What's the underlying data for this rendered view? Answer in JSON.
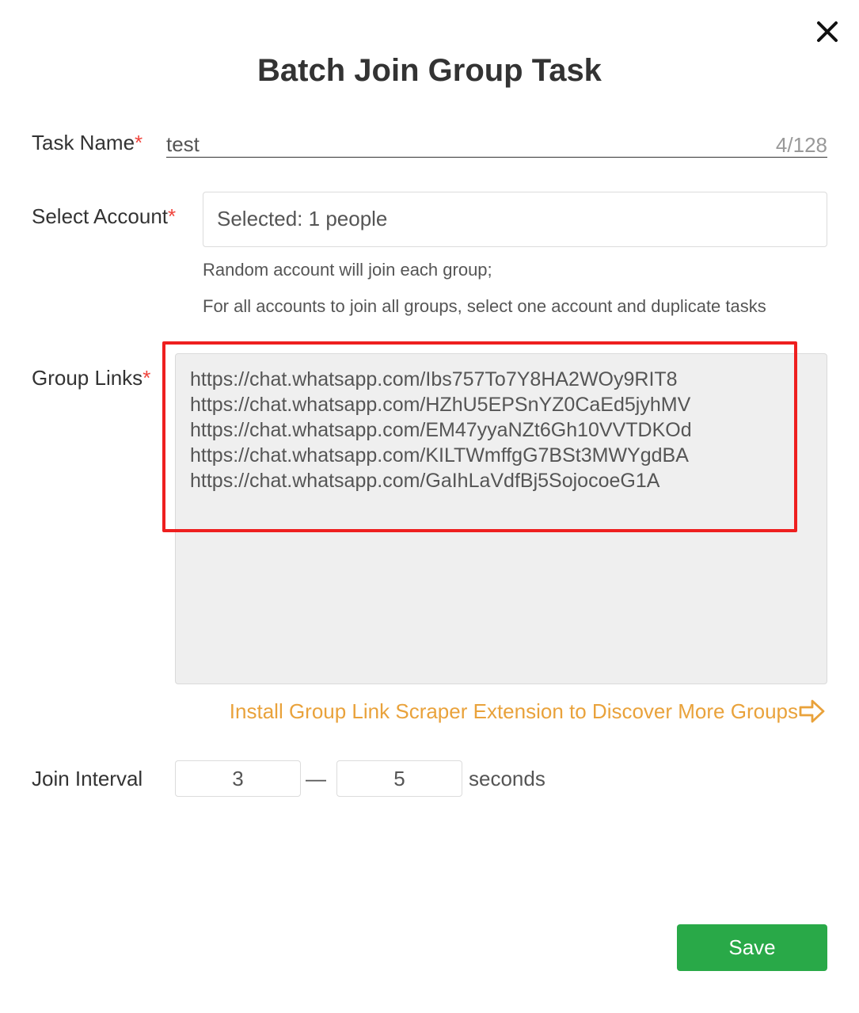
{
  "dialog": {
    "title": "Batch Join Group Task",
    "close_icon": "close-icon"
  },
  "task_name": {
    "label": "Task Name",
    "required_mark": "*",
    "value": "test",
    "counter": "4/128"
  },
  "select_account": {
    "label": "Select Account",
    "required_mark": "*",
    "value": "Selected: 1 people",
    "hint_1": "Random account will join each group;",
    "hint_2": "For all accounts to join all groups, select one account and duplicate tasks"
  },
  "group_links": {
    "label": "Group Links",
    "required_mark": "*",
    "links": [
      "https://chat.whatsapp.com/Ibs757To7Y8HA2WOy9RIT8",
      "https://chat.whatsapp.com/HZhU5EPSnYZ0CaEd5jyhMV",
      "https://chat.whatsapp.com/EM47yyaNZt6Gh10VVTDKOd",
      "https://chat.whatsapp.com/KILTWmffgG7BSt3MWYgdBA",
      "https://chat.whatsapp.com/GaIhLaVdfBj5SojocoeG1A"
    ]
  },
  "scraper_link": {
    "text": "Install Group Link Scraper Extension to Discover More Groups",
    "icon": "arrow-right-icon"
  },
  "join_interval": {
    "label": "Join Interval",
    "min": "3",
    "separator": "—",
    "max": "5",
    "unit": "seconds"
  },
  "save_button": {
    "label": "Save"
  },
  "colors": {
    "required": "#f0443c",
    "link": "#e9a23b",
    "primary": "#29a948",
    "highlight": "#ee1f1f",
    "textarea_bg": "#efefef"
  }
}
